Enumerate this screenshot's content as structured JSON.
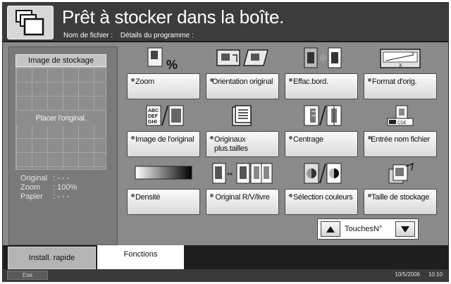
{
  "header": {
    "title": "Prêt à stocker dans la boîte.",
    "filename_label": "Nom de fichier :",
    "details_label": "Détails du programme :",
    "icon": "copy-stack-icon"
  },
  "preview": {
    "title": "Image de stockage",
    "message": "Placer l'original.",
    "info": [
      {
        "label": "Original",
        "value": ":  - - -"
      },
      {
        "label": "Zoom",
        "value": ":  100%"
      },
      {
        "label": "Papier",
        "value": ":  - - -"
      }
    ]
  },
  "functions": [
    {
      "label": "Zoom",
      "icon": "zoom-percent-icon"
    },
    {
      "label": "Orientation original",
      "icon": "original-orientation-icon"
    },
    {
      "label": "Effac.bord.",
      "icon": "border-erase-icon"
    },
    {
      "label": "Format d'orig.",
      "icon": "original-size-icon"
    },
    {
      "label": "Image de l'original",
      "icon": "original-image-icon"
    },
    {
      "label": "Originaux plus.tailles",
      "icon": "mixed-size-originals-icon"
    },
    {
      "label": "Centrage",
      "icon": "centering-icon"
    },
    {
      "label": "Entrée nom fichier",
      "icon": "file-name-entry-icon"
    },
    {
      "label": "Densité",
      "icon": "density-gradient-icon"
    },
    {
      "label": "Original R/V/livre",
      "icon": "duplex-book-original-icon"
    },
    {
      "label": "Sélection couleurs",
      "icon": "color-selection-icon"
    },
    {
      "label": "Taille de stockage",
      "icon": "storage-size-icon"
    }
  ],
  "pager": {
    "label": "TouchesN°"
  },
  "tabs": {
    "quick": "Install. rapide",
    "functions": "Fonctions"
  },
  "status": {
    "button": "Etat",
    "date": "10/5/2006",
    "time": "10:10"
  }
}
